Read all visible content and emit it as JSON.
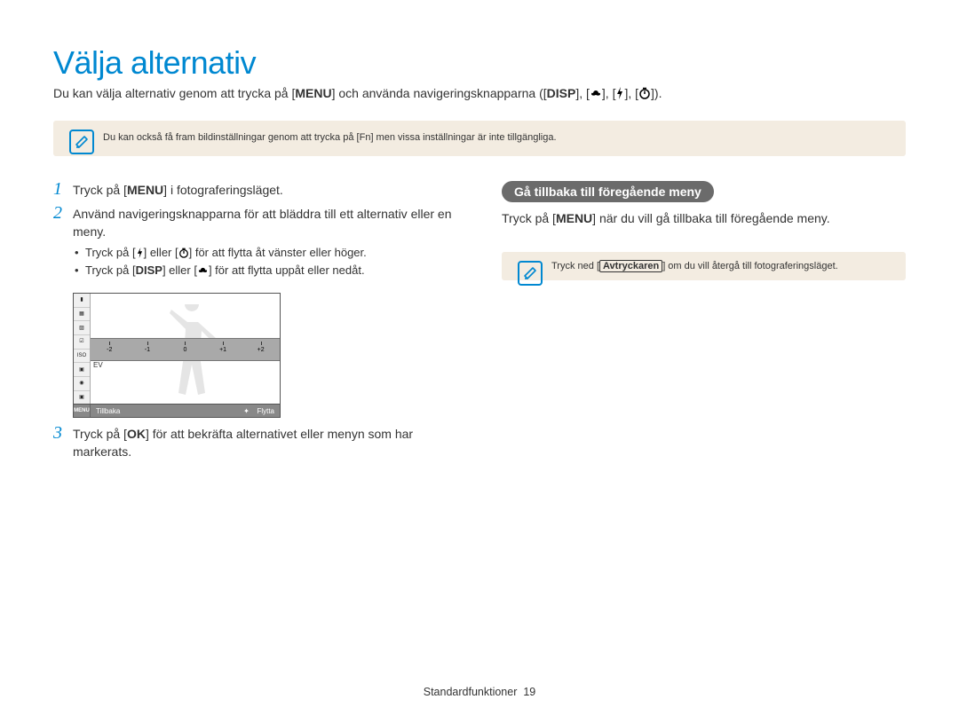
{
  "title": "Välja alternativ",
  "intro": {
    "text1": "Du kan välja alternativ genom att trycka på [",
    "menu": "MENU",
    "text2": "] och använda navigeringsknapparna ([",
    "disp": "DISP",
    "text3": "], [",
    "text4": "], [",
    "text5": "], [",
    "text6": "])."
  },
  "note_top": {
    "text1": "Du kan också få fram bildinställningar genom att trycka på [",
    "fn": "Fn",
    "text2": "] men vissa inställningar är inte tillgängliga."
  },
  "steps": {
    "s1": {
      "num": "1",
      "text1": "Tryck på [",
      "menu": "MENU",
      "text2": "] i fotograferingsläget."
    },
    "s2": {
      "num": "2",
      "text": "Använd navigeringsknapparna för att bläddra till ett alternativ eller en meny.",
      "sub1": {
        "a": "Tryck på [",
        "b": "] eller [",
        "c": "] för att flytta åt vänster eller höger."
      },
      "sub2": {
        "a": "Tryck på [",
        "disp": "DISP",
        "b": "] eller [",
        "c": "] för att flytta uppåt eller nedåt."
      }
    },
    "s3": {
      "num": "3",
      "text1": "Tryck på [",
      "ok": "OK",
      "text2": "] för att bekräfta alternativet eller menyn som har markerats."
    }
  },
  "preview": {
    "ticks": [
      "-2",
      "-1",
      "0",
      "+1",
      "+2"
    ],
    "sidebar_label": "ISO",
    "label": "EV",
    "footer_menu": "MENU",
    "footer_left": "Tillbaka",
    "footer_right": "Flytta"
  },
  "right": {
    "heading": "Gå tillbaka till föregående meny",
    "text1": "Tryck på [",
    "menu": "MENU",
    "text2": "] när du vill gå tillbaka till föregående meny.",
    "note": {
      "a": "Tryck ned [",
      "shutter": "Avtryckaren",
      "b": "] om du vill återgå till fotograferingsläget."
    }
  },
  "footer": {
    "section": "Standardfunktioner",
    "page": "19"
  }
}
